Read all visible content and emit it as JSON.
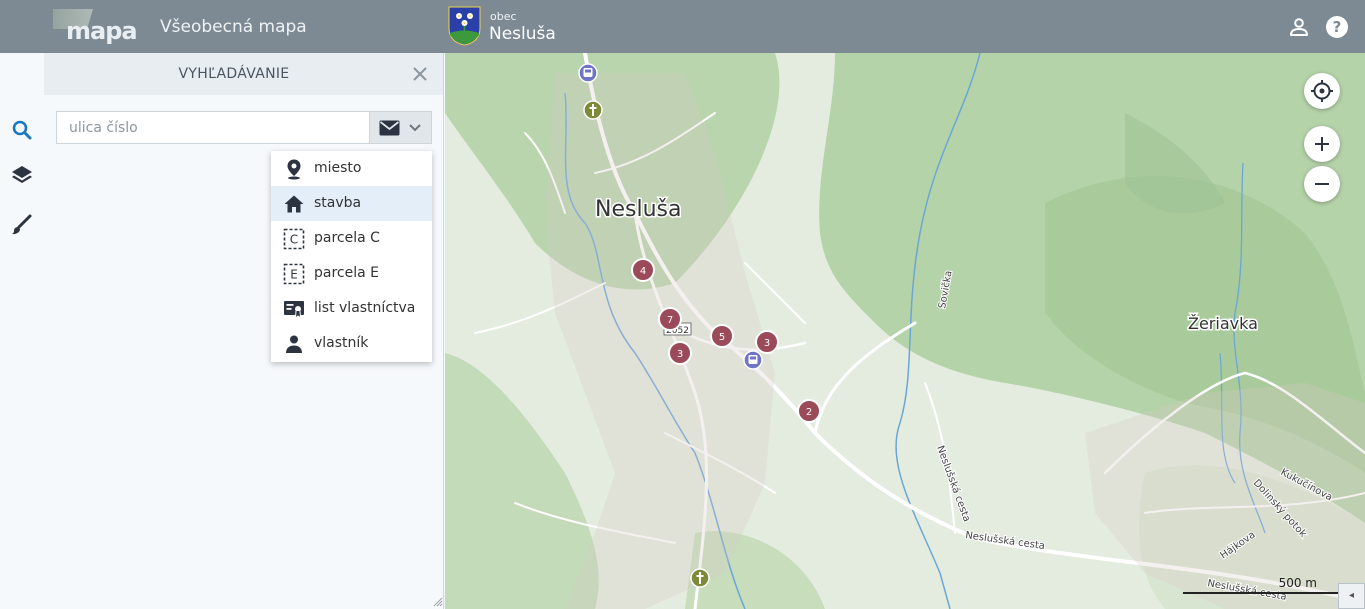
{
  "header": {
    "logo_text": "mapa",
    "app_title": "Všeobecná mapa",
    "municipality_type": "obec",
    "municipality_name": "Nesluša",
    "icons": [
      "user-icon",
      "help-icon"
    ]
  },
  "leftrail": {
    "items": [
      {
        "name": "search",
        "icon": "search-icon",
        "active": true
      },
      {
        "name": "layers",
        "icon": "layers-icon",
        "active": false
      },
      {
        "name": "tools",
        "icon": "brush-icon",
        "active": false
      }
    ]
  },
  "panel": {
    "title": "VYHĽADÁVANIE",
    "search_placeholder": "ulica číslo",
    "search_value": "",
    "type_button_icon": "envelope-icon"
  },
  "dropdown": {
    "items": [
      {
        "label": "miesto",
        "icon": "map-pin-icon",
        "selected": false
      },
      {
        "label": "stavba",
        "icon": "house-icon",
        "selected": true
      },
      {
        "label": "parcela C",
        "icon": "parcel-c-icon",
        "selected": false
      },
      {
        "label": "parcela E",
        "icon": "parcel-e-icon",
        "selected": false
      },
      {
        "label": "list vlastníctva",
        "icon": "ownership-sheet-icon",
        "selected": false
      },
      {
        "label": "vlastník",
        "icon": "owner-icon",
        "selected": false
      }
    ]
  },
  "map": {
    "labels": {
      "town1": "Nesluša",
      "town2": "Žeriavka",
      "stream": "Sovička",
      "road1": "Neslušská cesta",
      "road2": "Neslušská cesta",
      "road3": "Neslušská cesta",
      "street1": "Kukučínova",
      "street2": "Dolinský potok",
      "street3": "Hájkova",
      "road_number": "2052"
    },
    "clusters": [
      {
        "count": "4"
      },
      {
        "count": "7"
      },
      {
        "count": "3"
      },
      {
        "count": "5"
      },
      {
        "count": "3"
      },
      {
        "count": "2"
      }
    ],
    "scale_label": "500 m",
    "colors": {
      "cluster": "#9b4a5a",
      "bus": "#6f74c9",
      "cemetery": "#7d8a37"
    }
  }
}
